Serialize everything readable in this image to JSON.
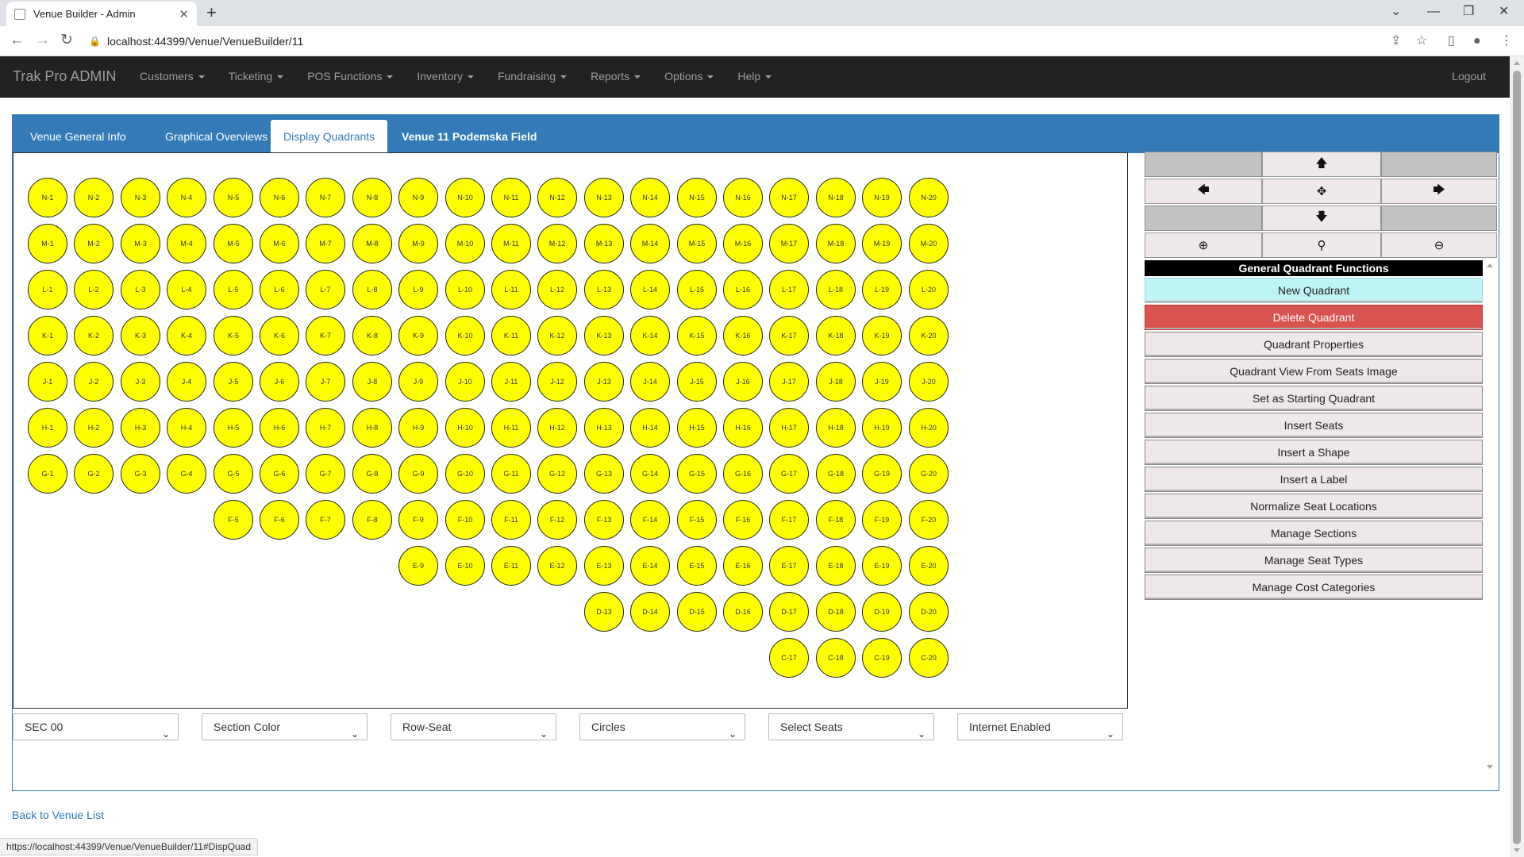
{
  "browser": {
    "tab_title": "Venue Builder - Admin",
    "url": "localhost:44399/Venue/VenueBuilder/11",
    "status_url": "https://localhost:44399/Venue/VenueBuilder/11#DispQuad"
  },
  "app": {
    "brand": "Trak Pro ADMIN",
    "menu": [
      "Customers",
      "Ticketing",
      "POS Functions",
      "Inventory",
      "Fundraising",
      "Reports",
      "Options",
      "Help"
    ],
    "logout": "Logout"
  },
  "venue_tabs": [
    "Venue General Info",
    "Graphical Overviews",
    "Display Quadrants",
    "Venue 11 Podemska Field"
  ],
  "seat_map": {
    "seat_color": "#ffff00",
    "rows": [
      {
        "row": "N",
        "start": 1,
        "end": 20
      },
      {
        "row": "M",
        "start": 1,
        "end": 20
      },
      {
        "row": "L",
        "start": 1,
        "end": 20
      },
      {
        "row": "K",
        "start": 1,
        "end": 20
      },
      {
        "row": "J",
        "start": 1,
        "end": 20
      },
      {
        "row": "H",
        "start": 1,
        "end": 20
      },
      {
        "row": "G",
        "start": 1,
        "end": 20
      },
      {
        "row": "F",
        "start": 5,
        "end": 20
      },
      {
        "row": "E",
        "start": 9,
        "end": 20
      },
      {
        "row": "D",
        "start": 13,
        "end": 20
      },
      {
        "row": "C",
        "start": 17,
        "end": 20
      }
    ]
  },
  "functions": {
    "header": "General Quadrant Functions",
    "buttons": [
      "New Quadrant",
      "Delete Quadrant",
      "Quadrant Properties",
      "Quadrant View From Seats Image",
      "Set as Starting Quadrant",
      "Insert Seats",
      "Insert a Shape",
      "Insert a Label",
      "Normalize Seat Locations",
      "Manage Sections",
      "Manage Seat Types",
      "Manage Cost Categories"
    ]
  },
  "selects": [
    "SEC 00",
    "Section Color",
    "Row-Seat",
    "Circles",
    "Select Seats",
    "Internet Enabled"
  ],
  "footer": {
    "back_link": "Back to Venue List"
  }
}
